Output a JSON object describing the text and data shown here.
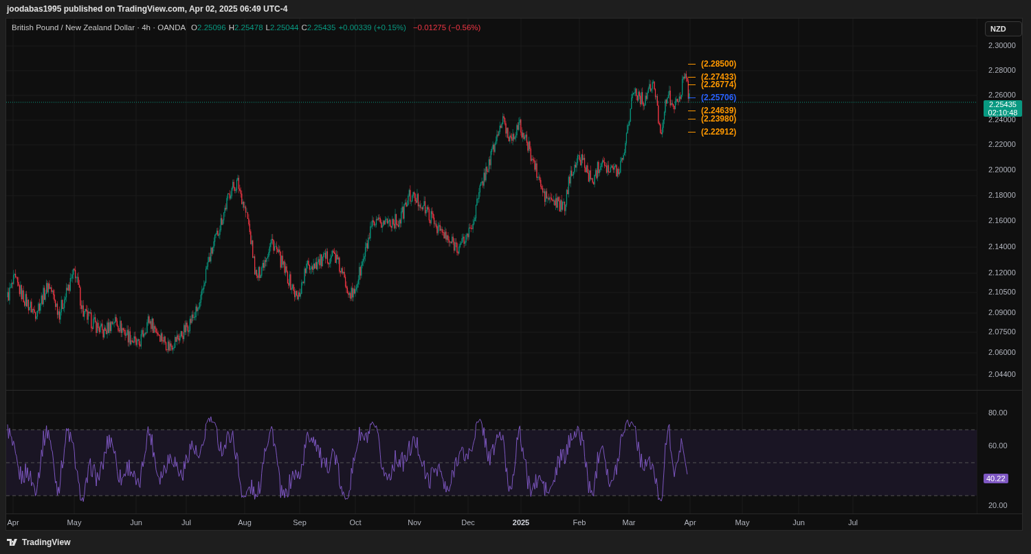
{
  "header": {
    "text": "joodabas1995 published on TradingView.com, Apr 02, 2025 06:49 UTC-4"
  },
  "legend": {
    "title": "British Pound / New Zealand Dollar · 4h · OANDA",
    "ohlc": [
      {
        "label": "O",
        "value": "2.25096"
      },
      {
        "label": "H",
        "value": "2.25478"
      },
      {
        "label": "L",
        "value": "2.25044"
      },
      {
        "label": "C",
        "value": "2.25435"
      }
    ],
    "change": "+0.00339 (+0.15%)",
    "change_2": "−0.01275 (−0.56%)"
  },
  "currency_button": "NZD",
  "price_axis": {
    "ticks": [
      "2.30000",
      "2.28000",
      "2.26000",
      "2.24000",
      "2.22000",
      "2.20000",
      "2.18000",
      "2.16000",
      "2.14000",
      "2.12000",
      "2.10500",
      "2.09000",
      "2.07500",
      "2.06000",
      "2.04400"
    ]
  },
  "current_price": {
    "price": "2.25435",
    "countdown": "02:10:48"
  },
  "levels": [
    {
      "label": "(2.28500)",
      "color": "#ff9800"
    },
    {
      "label": "(2.27433)",
      "color": "#ff9800"
    },
    {
      "label": "(2.26774)",
      "color": "#ff9800"
    },
    {
      "label": "(2.25706)",
      "color": "#2962ff"
    },
    {
      "label": "(2.24639)",
      "color": "#ff9800"
    },
    {
      "label": "(2.23980)",
      "color": "#ff9800"
    },
    {
      "label": "(2.22912)",
      "color": "#ff9800"
    }
  ],
  "rsi": {
    "ticks": [
      "80.00",
      "60.00",
      "20.00"
    ],
    "value": "40.22"
  },
  "time_axis": [
    {
      "label": "Apr",
      "kind": "month"
    },
    {
      "label": "May",
      "kind": "month"
    },
    {
      "label": "Jun",
      "kind": "month"
    },
    {
      "label": "Jul",
      "kind": "month"
    },
    {
      "label": "Aug",
      "kind": "month"
    },
    {
      "label": "Sep",
      "kind": "month"
    },
    {
      "label": "Oct",
      "kind": "month"
    },
    {
      "label": "Nov",
      "kind": "month"
    },
    {
      "label": "Dec",
      "kind": "month"
    },
    {
      "label": "2025",
      "kind": "year"
    },
    {
      "label": "Feb",
      "kind": "month"
    },
    {
      "label": "Mar",
      "kind": "month"
    },
    {
      "label": "Apr",
      "kind": "month"
    },
    {
      "label": "May",
      "kind": "month"
    },
    {
      "label": "Jun",
      "kind": "month"
    },
    {
      "label": "Jul",
      "kind": "month"
    }
  ],
  "footer": {
    "brand": "TradingView"
  }
}
